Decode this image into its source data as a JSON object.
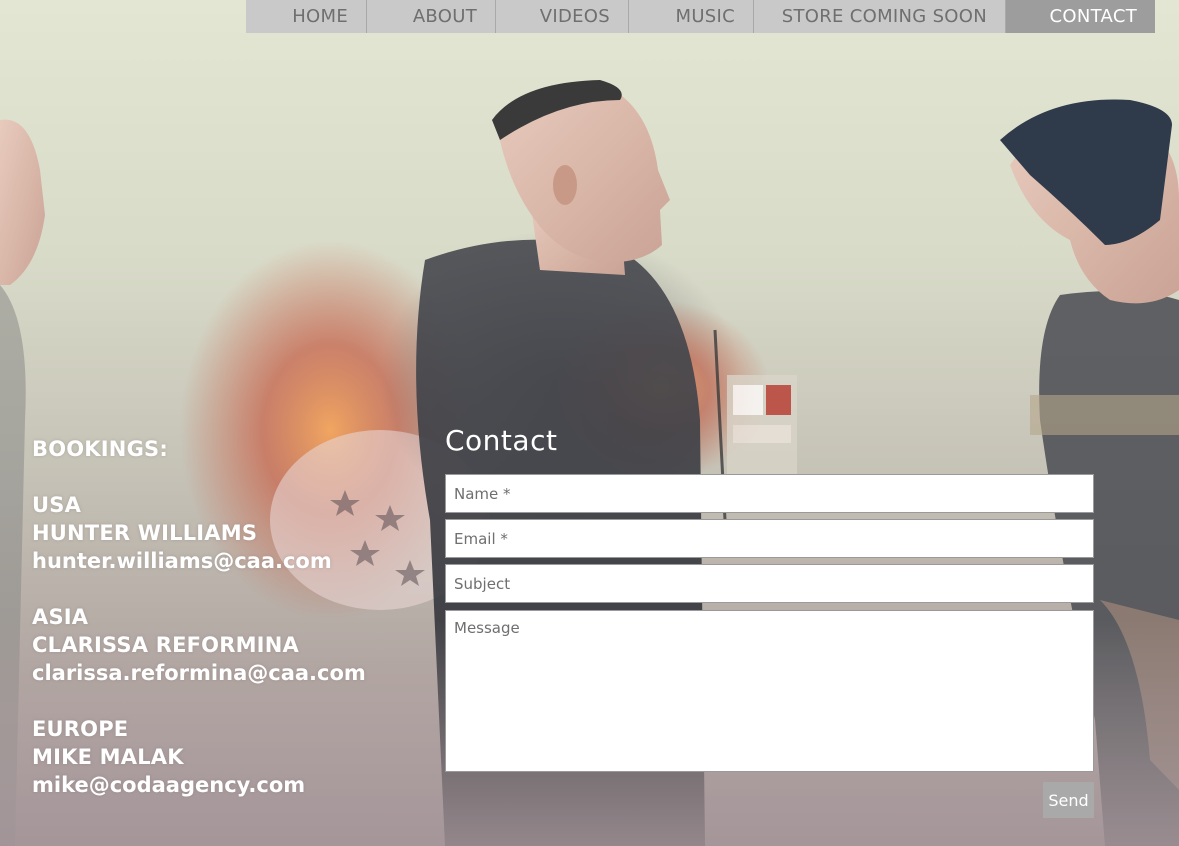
{
  "nav": {
    "items": [
      {
        "label": "HOME",
        "active": false
      },
      {
        "label": "ABOUT",
        "active": false
      },
      {
        "label": "VIDEOS",
        "active": false
      },
      {
        "label": "MUSIC",
        "active": false
      },
      {
        "label": "STORE COMING SOON",
        "active": false
      },
      {
        "label": "CONTACT",
        "active": true
      }
    ]
  },
  "bookings": {
    "heading": "BOOKINGS:",
    "contacts": [
      {
        "region": "USA",
        "agent": "HUNTER WILLIAMS",
        "email": "hunter.williams@caa.com"
      },
      {
        "region": "ASIA",
        "agent": "CLARISSA REFORMINA",
        "email": "clarissa.reformina@caa.com"
      },
      {
        "region": "EUROPE",
        "agent": "MIKE MALAK",
        "email": "mike@codaagency.com"
      }
    ]
  },
  "contact": {
    "title": "Contact",
    "name_placeholder": "Name *",
    "email_placeholder": "Email *",
    "subject_placeholder": "Subject",
    "message_placeholder": "Message",
    "send_label": "Send"
  },
  "colors": {
    "nav_bg": "#c9c9c9",
    "nav_active_bg": "#9d9d9d",
    "nav_text": "#6f6f6f",
    "send_bg": "#a9a9a9"
  }
}
